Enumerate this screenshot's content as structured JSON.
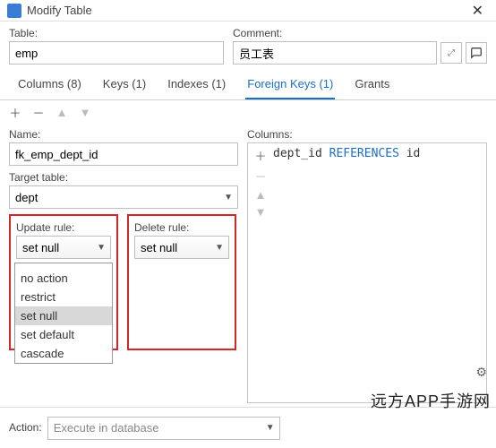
{
  "window": {
    "title": "Modify Table"
  },
  "top": {
    "table_label": "Table:",
    "table_value": "emp",
    "comment_label": "Comment:",
    "comment_value": "员工表"
  },
  "tabs": {
    "columns": "Columns (8)",
    "keys": "Keys (1)",
    "indexes": "Indexes (1)",
    "fkeys": "Foreign Keys (1)",
    "grants": "Grants"
  },
  "fk": {
    "name_label": "Name:",
    "name_value": "fk_emp_dept_id",
    "target_label": "Target table:",
    "target_value": "dept",
    "update_label": "Update rule:",
    "update_value": "set null",
    "delete_label": "Delete rule:",
    "delete_value": "set null",
    "options": {
      "none": "",
      "noaction": "no action",
      "restrict": "restrict",
      "setnull": "set null",
      "setdefault": "set default",
      "cascade": "cascade"
    }
  },
  "columns_panel": {
    "label": "Columns:",
    "col": "dept_id",
    "ref_kw": "REFERENCES",
    "ref_target": "id"
  },
  "action": {
    "label": "Action:",
    "value": "Execute in database"
  },
  "watermark": "远方APP手游网"
}
